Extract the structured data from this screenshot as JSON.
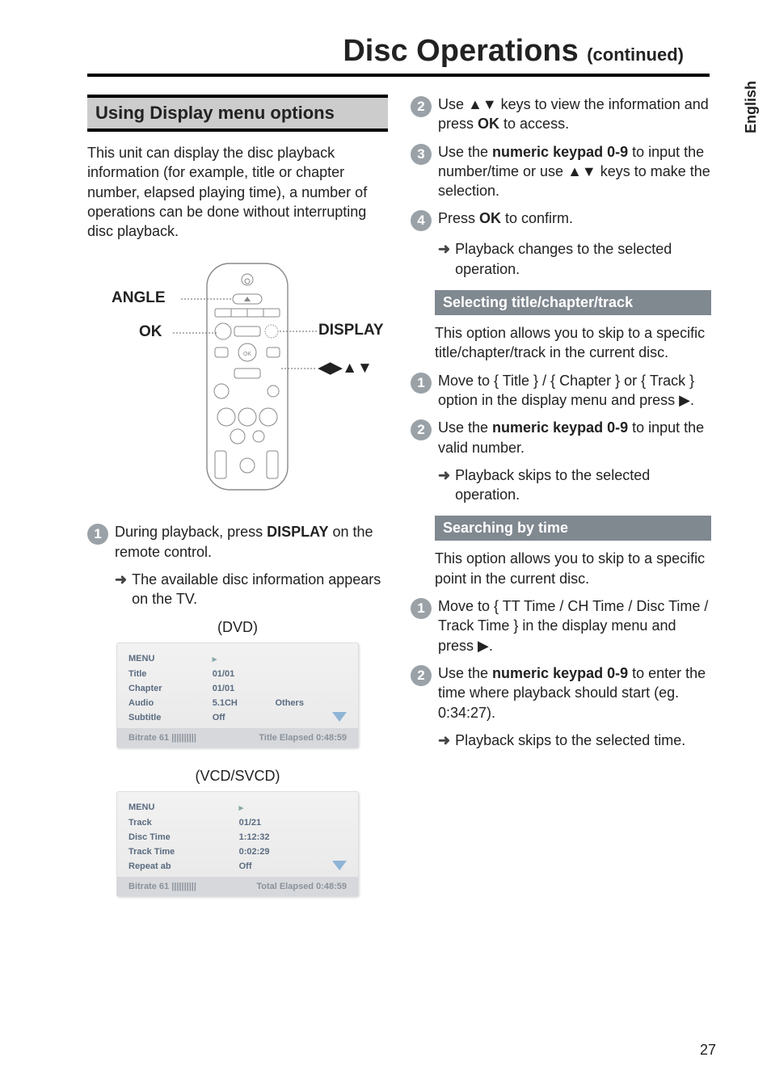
{
  "page": {
    "number": "27",
    "side_tab": "English"
  },
  "title": {
    "main": "Disc Operations",
    "sub": "(continued)"
  },
  "left": {
    "section_head": "Using Display menu options",
    "intro": "This unit can display the disc playback information (for example, title or chapter number, elapsed playing time), a number of operations can be done without interrupting disc playback.",
    "remote_labels": {
      "angle": "ANGLE",
      "ok": "OK",
      "display": "DISPLAY",
      "arrows": "◀▶▲▼"
    },
    "step1_pre": "During playback, press ",
    "step1_strong": "DISPLAY",
    "step1_post": " on the remote control.",
    "arrow1": "The available disc information appears on the TV.",
    "caption_dvd": "(DVD)",
    "caption_vcd": "(VCD/SVCD)",
    "menu_dvd": {
      "head_menu": "MENU",
      "rows": [
        [
          "Title",
          "01/01",
          ""
        ],
        [
          "Chapter",
          "01/01",
          ""
        ],
        [
          "Audio",
          "5.1CH",
          "Others"
        ],
        [
          "Subtitle",
          "Off",
          ""
        ]
      ],
      "foot_left": "Bitrate   61  ||||||||||",
      "foot_right": "Title Elapsed   0:48:59"
    },
    "menu_vcd": {
      "head_menu": "MENU",
      "rows": [
        [
          "Track",
          "01/21",
          ""
        ],
        [
          "Disc  Time",
          "1:12:32",
          ""
        ],
        [
          "Track  Time",
          "0:02:29",
          ""
        ],
        [
          "Repeat  ab",
          "Off",
          ""
        ]
      ],
      "foot_left": "Bitrate   61  ||||||||||",
      "foot_right": "Total Elapsed   0:48:59"
    }
  },
  "right": {
    "step2": {
      "pre": "Use ▲▼ keys to view the information and press ",
      "strong": "OK",
      "post": " to access."
    },
    "step3": {
      "pre": "Use the ",
      "strong": "numeric keypad 0-9",
      "post": " to input the number/time or use ▲▼ keys to make the selection."
    },
    "step4": {
      "pre": "Press ",
      "strong": "OK",
      "post": " to confirm."
    },
    "step4_arrow": "Playback changes to the selected operation.",
    "sub1_head": "Selecting title/chapter/track",
    "sub1_intro": "This option allows you to skip to a specific title/chapter/track in the current disc.",
    "sub1_step1": "Move to { Title } / { Chapter } or { Track } option in the display menu and press ▶.",
    "sub1_step2": {
      "pre": "Use the ",
      "strong": "numeric keypad 0-9",
      "post": " to input the valid number."
    },
    "sub1_arrow": "Playback skips to the selected operation.",
    "sub2_head": "Searching by time",
    "sub2_intro": "This option allows you to skip to a specific point in the current disc.",
    "sub2_step1": "Move to { TT Time / CH Time / Disc Time / Track Time } in the display menu and press ▶.",
    "sub2_step2": {
      "pre": "Use the ",
      "strong": "numeric keypad 0-9",
      "post": " to enter the time where playback should start (eg. 0:34:27)."
    },
    "sub2_arrow": "Playback skips to the selected time."
  }
}
